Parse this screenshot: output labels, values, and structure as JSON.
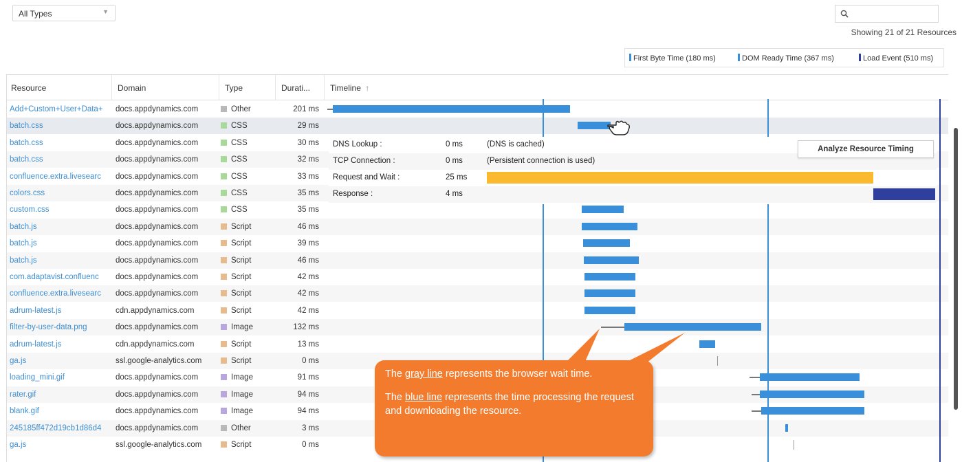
{
  "filter": {
    "selected": "All Types"
  },
  "summary": {
    "count_text": "Showing 21 of 21 Resources"
  },
  "legend": {
    "items": [
      {
        "label": "First Byte Time (180 ms)",
        "color": "#3a8fdb"
      },
      {
        "label": "DOM Ready Time (367 ms)",
        "color": "#3a8fdb"
      },
      {
        "label": "Load Event (510 ms)",
        "color": "#2e3f9e"
      }
    ]
  },
  "columns": {
    "resource": "Resource",
    "domain": "Domain",
    "type": "Type",
    "duration": "Durati...",
    "timeline": "Timeline",
    "timeline_sort_icon": "↑"
  },
  "type_colors": {
    "Other": "#b8b8b8",
    "CSS": "#a9d99a",
    "Script": "#e6bb8e",
    "Image": "#b9a6dd"
  },
  "rows": [
    {
      "resource": "Add+Custom+User+Data+",
      "domain": "docs.appdynamics.com",
      "type": "Other",
      "duration": "201 ms"
    },
    {
      "resource": "batch.css",
      "domain": "docs.appdynamics.com",
      "type": "CSS",
      "duration": "29 ms"
    },
    {
      "resource": "batch.css",
      "domain": "docs.appdynamics.com",
      "type": "CSS",
      "duration": "30 ms"
    },
    {
      "resource": "batch.css",
      "domain": "docs.appdynamics.com",
      "type": "CSS",
      "duration": "32 ms"
    },
    {
      "resource": "confluence.extra.livesearc",
      "domain": "docs.appdynamics.com",
      "type": "CSS",
      "duration": "33 ms"
    },
    {
      "resource": "colors.css",
      "domain": "docs.appdynamics.com",
      "type": "CSS",
      "duration": "35 ms"
    },
    {
      "resource": "custom.css",
      "domain": "docs.appdynamics.com",
      "type": "CSS",
      "duration": "35 ms"
    },
    {
      "resource": "batch.js",
      "domain": "docs.appdynamics.com",
      "type": "Script",
      "duration": "46 ms"
    },
    {
      "resource": "batch.js",
      "domain": "docs.appdynamics.com",
      "type": "Script",
      "duration": "39 ms"
    },
    {
      "resource": "batch.js",
      "domain": "docs.appdynamics.com",
      "type": "Script",
      "duration": "46 ms"
    },
    {
      "resource": "com.adaptavist.confluenc",
      "domain": "docs.appdynamics.com",
      "type": "Script",
      "duration": "42 ms"
    },
    {
      "resource": "confluence.extra.livesearc",
      "domain": "docs.appdynamics.com",
      "type": "Script",
      "duration": "42 ms"
    },
    {
      "resource": "adrum-latest.js",
      "domain": "cdn.appdynamics.com",
      "type": "Script",
      "duration": "42 ms"
    },
    {
      "resource": "filter-by-user-data.png",
      "domain": "docs.appdynamics.com",
      "type": "Image",
      "duration": "132 ms"
    },
    {
      "resource": "adrum-latest.js",
      "domain": "cdn.appdynamics.com",
      "type": "Script",
      "duration": "13 ms"
    },
    {
      "resource": "ga.js",
      "domain": "ssl.google-analytics.com",
      "type": "Script",
      "duration": "0 ms"
    },
    {
      "resource": "loading_mini.gif",
      "domain": "docs.appdynamics.com",
      "type": "Image",
      "duration": "91 ms"
    },
    {
      "resource": "rater.gif",
      "domain": "docs.appdynamics.com",
      "type": "Image",
      "duration": "94 ms"
    },
    {
      "resource": "blank.gif",
      "domain": "docs.appdynamics.com",
      "type": "Image",
      "duration": "94 ms"
    },
    {
      "resource": "245185ff472d19cb1d86d4",
      "domain": "docs.appdynamics.com",
      "type": "Other",
      "duration": "3 ms"
    },
    {
      "resource": "ga.js",
      "domain": "ssl.google-analytics.com",
      "type": "Script",
      "duration": "0 ms"
    }
  ],
  "timing_popup": {
    "rows": [
      {
        "label": "DNS Lookup :",
        "ms": "0 ms",
        "note": "(DNS is cached)"
      },
      {
        "label": "TCP Connection :",
        "ms": "0 ms",
        "note": "(Persistent connection is used)"
      },
      {
        "label": "Request and Wait :",
        "ms": "25 ms",
        "note": ""
      },
      {
        "label": "Response :",
        "ms": "4 ms",
        "note": ""
      }
    ],
    "request_color": "#fbb92f",
    "response_color": "#2e3f9e",
    "button_label": "Analyze Resource Timing"
  },
  "callout": {
    "p1_pre": "The ",
    "p1_link": "gray line",
    "p1_post": " represents the browser wait time.",
    "p2_pre": "The ",
    "p2_link": "blue line",
    "p2_post": " represents the time processing the request and downloading the resource.",
    "color": "#f37b2d"
  },
  "colors": {
    "link": "#3e8ed0",
    "bar": "#3a8fdb",
    "wait": "#777777"
  }
}
